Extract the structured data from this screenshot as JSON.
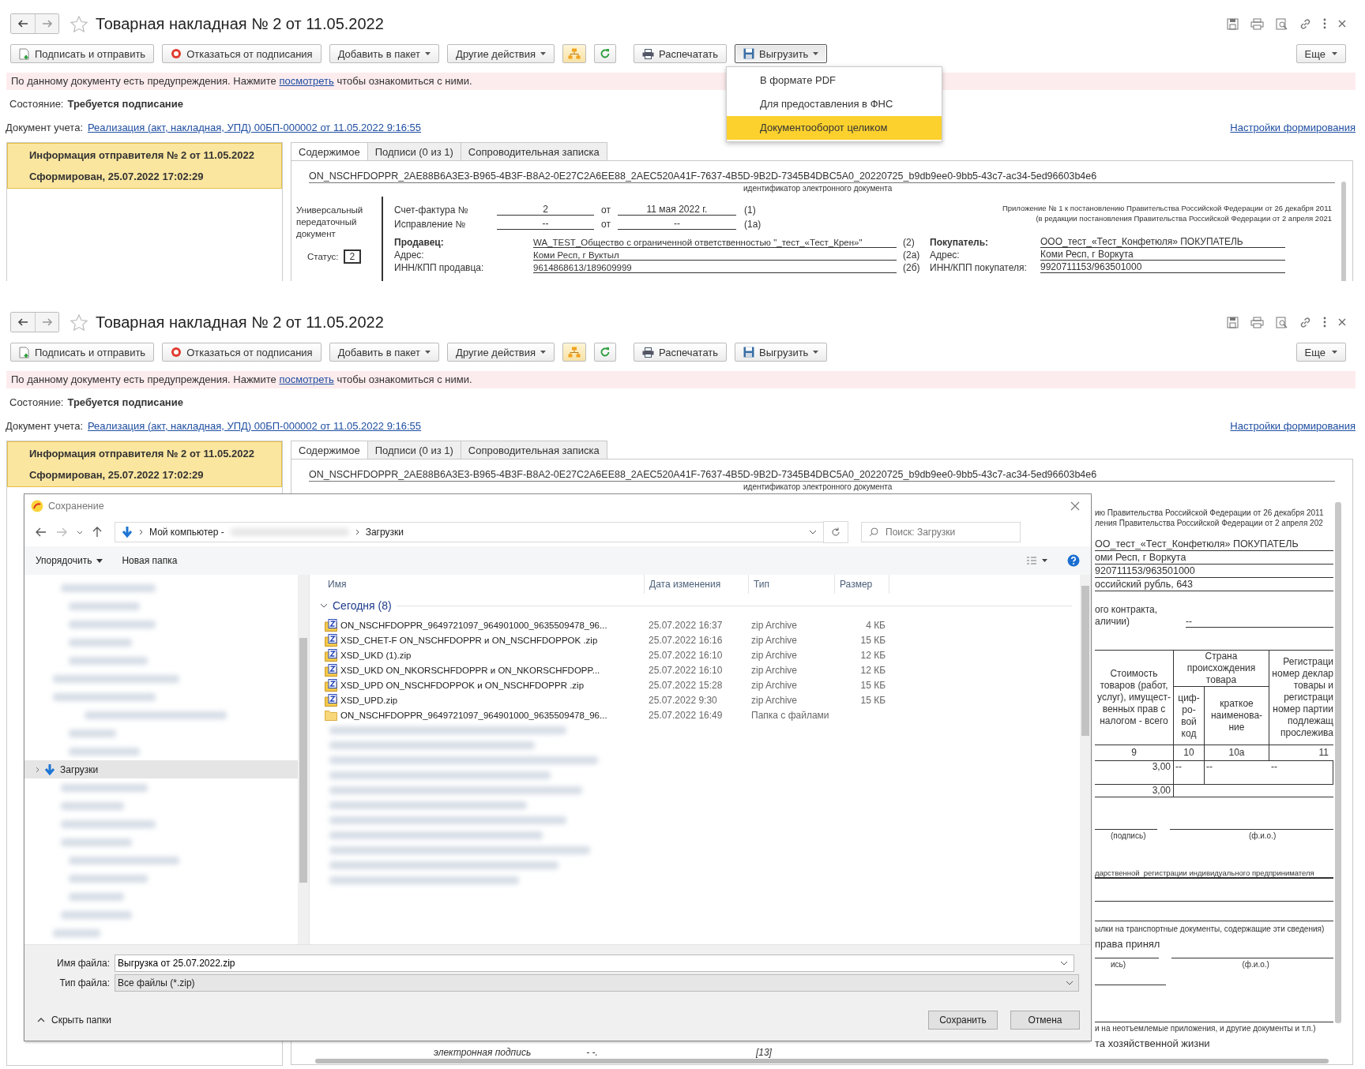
{
  "forms": [
    {
      "title": "Товарная накладная № 2 от 11.05.2022",
      "toolbar": [
        {
          "kind": "sign",
          "label": "Подписать и отправить",
          "pressed": false
        },
        {
          "kind": "cancel",
          "label": "Отказаться от подписания",
          "pressed": false
        },
        {
          "kind": "dropdown",
          "label": "Добавить в пакет",
          "pressed": false
        },
        {
          "kind": "dropdown",
          "label": "Другие действия",
          "pressed": false
        },
        {
          "kind": "tree",
          "pressed": false
        },
        {
          "kind": "refresh",
          "pressed": false
        },
        {
          "kind": "print",
          "label": "Распечатать",
          "pressed": false
        },
        {
          "kind": "export",
          "label": "Выгрузить",
          "pressed": true
        }
      ],
      "more_button": "Еще",
      "warning": {
        "before": "По данному документу есть предупреждения. Нажмите",
        "link": "посмотреть",
        "after": "чтобы ознакомиться с ними."
      },
      "state": {
        "label": "Состояние:",
        "value": "Требуется подписание"
      },
      "accounting_doc": {
        "label": "Документ учета:",
        "link": "Реализация (акт, накладная, УПД) 00БП-000002 от 11.05.2022 9:16:55"
      },
      "settings_link": "Настройки формирования",
      "sender_info": [
        "Информация отправителя № 2 от 11.05.2022",
        "Сформирован, 25.07.2022 17:02:29"
      ],
      "tabs": [
        {
          "label": "Содержимое",
          "selected": true
        },
        {
          "label": "Подписи (0 из 1)",
          "selected": false
        },
        {
          "label": "Сопроводительная записка",
          "selected": false
        }
      ],
      "doc_id": "ON_NSCHFDOPPR_2AE88B6A3E3-B965-4B3F-B8A2-0E27C2A6EE88_2AEC520A41F-7637-4B5D-9B2D-7345B4DBC5A0_20220725_b9db9ee0-9bb5-43c7-ac34-5ed96603b4e6",
      "doc_id_caption": "идентификатор электронного документа",
      "export_menu": [
        {
          "label": "В формате PDF",
          "selected": false
        },
        {
          "label": "Для предоставления в ФНС",
          "selected": false
        },
        {
          "label": "Документооборот целиком",
          "selected": true
        }
      ],
      "document": {
        "kind_title": "Универсальный передаточный документ",
        "status_label": "Статус:",
        "status": "2",
        "invoice_rows": [
          {
            "label": "Счет-фактура №",
            "number": "2",
            "from": "от",
            "date": "11 мая 2022 г.",
            "ref": "(1)"
          },
          {
            "label": "Исправление №",
            "number": "--",
            "from": "от",
            "date": "--",
            "ref": "(1а)"
          }
        ],
        "appendix": [
          "Приложение № 1 к постановлению Правительства Российской Федерации от 26 декабря 2011",
          "(в редакции постановления Правительства Российской Федерации от 2 апреля 2021"
        ],
        "parties": [
          {
            "kind": "name",
            "seller_label": "Продавец:",
            "seller_value": "WA_TEST_Общество с ограниченной ответственностью \"_тест_«Тест_Крен»\"",
            "ref": "(2)",
            "buyer_label": "Покупатель:",
            "buyer_value": "ООО_тест_«Тест_Конфетюля» ПОКУПАТЕЛЬ"
          },
          {
            "kind": "field",
            "seller_label": "Адрес:",
            "seller_value": "Коми Респ, г Вуктыл",
            "ref": "(2а)",
            "buyer_label": "Адрес:",
            "buyer_value": "Коми Респ, г Воркута"
          },
          {
            "kind": "field",
            "seller_label": "ИНН/КПП продавца:",
            "seller_value": "9614868613/189609999",
            "ref": "(2б)",
            "buyer_label": "ИНН/КПП покупателя:",
            "buyer_value": "9920711153/963501000"
          }
        ]
      }
    },
    {
      "title": "Товарная накладная № 2 от 11.05.2022",
      "toolbar": [
        {
          "kind": "sign",
          "label": "Подписать и отправить",
          "pressed": false
        },
        {
          "kind": "cancel",
          "label": "Отказаться от подписания",
          "pressed": false
        },
        {
          "kind": "dropdown",
          "label": "Добавить в пакет",
          "pressed": false
        },
        {
          "kind": "dropdown",
          "label": "Другие действия",
          "pressed": false
        },
        {
          "kind": "tree",
          "pressed": false
        },
        {
          "kind": "refresh",
          "pressed": false
        },
        {
          "kind": "print",
          "label": "Распечатать",
          "pressed": false
        },
        {
          "kind": "export",
          "label": "Выгрузить",
          "pressed": false
        }
      ],
      "more_button": "Еще",
      "warning": {
        "before": "По данному документу есть предупреждения. Нажмите",
        "link": "посмотреть",
        "after": "чтобы ознакомиться с ними."
      },
      "state": {
        "label": "Состояние:",
        "value": "Требуется подписание"
      },
      "accounting_doc": {
        "label": "Документ учета:",
        "link": "Реализация (акт, накладная, УПД) 00БП-000002 от 11.05.2022 9:16:55"
      },
      "settings_link": "Настройки формирования",
      "sender_info": [
        "Информация отправителя № 2 от 11.05.2022",
        "Сформирован, 25.07.2022 17:02:29"
      ],
      "tabs": [
        {
          "label": "Содержимое",
          "selected": true
        },
        {
          "label": "Подписи (0 из 1)",
          "selected": false
        },
        {
          "label": "Сопроводительная записка",
          "selected": false
        }
      ],
      "doc_id": "ON_NSCHFDOPPR_2AE88B6A3E3-B965-4B3F-B8A2-0E27C2A6EE88_2AEC520A41F-7637-4B5D-9B2D-7345B4DBC5A0_20220725_b9db9ee0-9bb5-43c7-ac34-5ed96603b4e6",
      "doc_id_caption": "идентификатор электронного документа",
      "document_fragments": {
        "appendix": [
          "ию Правительства Российской Федерации от 26 декабря 2011",
          "ления Правительства Российской Федерации от 2 апреля 202"
        ],
        "buyer_rows": [
          "ОО_тест_«Тест_Конфетюля» ПОКУПАТЕЛЬ",
          "оми Респ, г Воркута",
          "920711153/963501000",
          "оссийский рубль, 643"
        ],
        "contract": [
          "ого контракта,",
          "аличии)"
        ],
        "contract_value": "--",
        "table": {
          "cost_header": [
            "Стоимость",
            "товаров (работ,",
            "услуг), имущест-",
            "венных прав с",
            "налогом - всего"
          ],
          "country_header": "Страна происхождения товара",
          "code_header": [
            "циф-",
            "ро-",
            "вой",
            "код"
          ],
          "name_header": [
            "краткое",
            "наименова-",
            "ние"
          ],
          "reg_header": [
            "Регистраци",
            "номер деклар",
            "товары и",
            "регистраци",
            "номер партии",
            "подлежащ",
            "прослежива"
          ],
          "numbers": [
            "9",
            "10",
            "10а",
            "11"
          ],
          "row": [
            "3,00",
            "--",
            "--",
            "--"
          ],
          "total": "3,00"
        },
        "captions": [
          "(подпись)",
          "(ф.и.о.)"
        ],
        "registration": "дарственной  регистрации индивидуального предпринимателя",
        "transport": "ылки на транспортные документы, содержащие эти сведения)",
        "accepted": "права принял",
        "captions2": [
          "ись)",
          "(ф.и.о.)"
        ],
        "attachments": "и на неотъемлемые приложения, и другие  документы и т.п.)",
        "fact": "та хозяйственной жизни",
        "signature_row": [
          "электронная подпись",
          "- -.",
          "[13]"
        ]
      },
      "save_dialog": {
        "title": "Сохранение",
        "path_root": "Мой компьютер -",
        "path_folder": "Загрузки",
        "search_placeholder": "Поиск: Загрузки",
        "toolbar": [
          {
            "kind": "dropdown",
            "label": "Упорядочить"
          },
          {
            "kind": "button",
            "label": "Новая папка"
          }
        ],
        "tree_item": {
          "label": "Загрузки",
          "selected": true
        },
        "columns": [
          "Имя",
          "Дата изменения",
          "Тип",
          "Размер"
        ],
        "group": {
          "label": "Сегодня (8)",
          "expanded": true
        },
        "files": [
          {
            "kind": "zip",
            "name": "ON_NSCHFDOPPR_9649721097_964901000_9635509478_96...",
            "date": "25.07.2022 16:37",
            "type": "zip Archive",
            "size": "4 КБ"
          },
          {
            "kind": "zip",
            "name": "XSD_CHET-F ON_NSCHFDOPPR и ON_NSCHFDOPPOK .zip",
            "date": "25.07.2022 16:16",
            "type": "zip Archive",
            "size": "15 КБ"
          },
          {
            "kind": "zip",
            "name": "XSD_UKD (1).zip",
            "date": "25.07.2022 16:10",
            "type": "zip Archive",
            "size": "12 КБ"
          },
          {
            "kind": "zip",
            "name": "XSD_UKD ON_NKORSCHFDOPPR и ON_NKORSCHFDOPP...",
            "date": "25.07.2022 16:10",
            "type": "zip Archive",
            "size": "12 КБ"
          },
          {
            "kind": "zip",
            "name": "XSD_UPD  ON_NSCHFDOPPOK и ON_NSCHFDOPPR .zip",
            "date": "25.07.2022 15:28",
            "type": "zip Archive",
            "size": "15 КБ"
          },
          {
            "kind": "zip",
            "name": "XSD_UPD.zip",
            "date": "25.07.2022 9:30",
            "type": "zip Archive",
            "size": "15 КБ"
          },
          {
            "kind": "folder",
            "name": "ON_NSCHFDOPPR_9649721097_964901000_9635509478_96...",
            "date": "25.07.2022 16:49",
            "type": "Папка с файлами"
          }
        ],
        "filename": {
          "label": "Имя файла:",
          "value": "Выгрузка от 25.07.2022.zip"
        },
        "filetype": {
          "label": "Тип файла:",
          "value": "Все файлы (*.zip)"
        },
        "hide_folders": "Скрыть папки",
        "buttons": [
          "Сохранить",
          "Отмена"
        ]
      }
    }
  ]
}
